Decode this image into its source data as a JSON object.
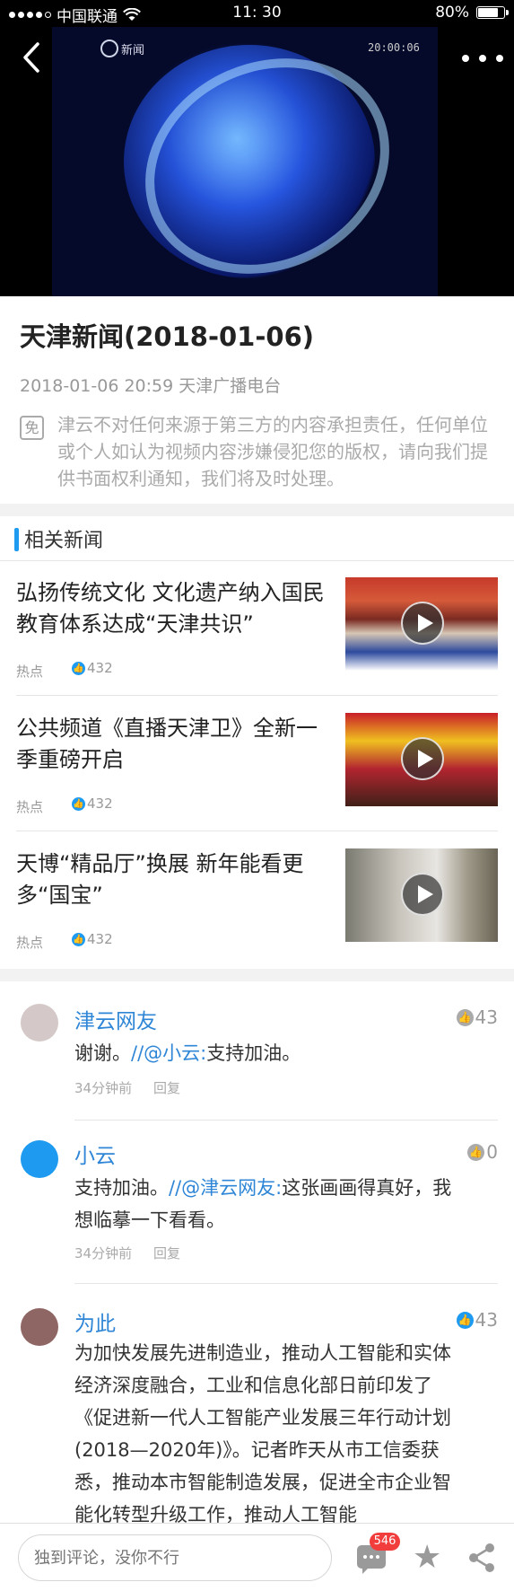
{
  "status_bar": {
    "carrier": "中国联通",
    "time": "11: 30",
    "battery": "80%",
    "battery_level": 0.8
  },
  "video": {
    "channel_logo_text": "新闻",
    "timecode": "20:00:06"
  },
  "article": {
    "title": "天津新闻(2018-01-06)",
    "date": "2018-01-06 20:59",
    "source": "天津广播电台",
    "disclaimer_icon": "免",
    "disclaimer": "津云不对任何来源于第三方的内容承担责任，任何单位或个人如认为视频内容涉嫌侵犯您的版权，请向我们提供书面权利通知，我们将及时处理。"
  },
  "related": {
    "section_title": "相关新闻",
    "items": [
      {
        "title": "弘扬传统文化 文化遗产纳入国民教育体系达成“天津共识”",
        "tag": "热点",
        "likes": "432"
      },
      {
        "title": "公共频道《直播天津卫》全新一季重磅开启",
        "tag": "热点",
        "likes": "432"
      },
      {
        "title": "天博“精品厅”换展 新年能看更多“国宝”",
        "tag": "热点",
        "likes": "432"
      }
    ]
  },
  "comments": [
    {
      "name": "津云网友",
      "likes": "43",
      "text_before": "谢谢。",
      "mention": "//@小云:",
      "text_after": "支持加油。",
      "time": "34分钟前",
      "reply": "回复",
      "avatar_color": "#d4c9c8"
    },
    {
      "name": "小云",
      "likes": "0",
      "text_before": "支持加油。",
      "mention": "//@津云网友:",
      "text_after": "这张画画得真好，我想临摹一下看看。",
      "time": "34分钟前",
      "reply": "回复",
      "avatar_color": "#1e9bf0"
    },
    {
      "name": "为此",
      "likes": "43",
      "text_before": "为加快发展先进制造业，推动人工智能和实体经济深度融合，工业和信息化部日前印发了《促进新一代人工智能产业发展三年行动计划(2018—2020年)》。记者昨天从市工信委获悉，推动本市智能制造发展，促进全市企业智能化转型升级工作，推动人工智能",
      "mention": "",
      "text_after": "",
      "avatar_color": "#8e6663"
    }
  ],
  "bottom_bar": {
    "input_placeholder": "独到评论，没你不行",
    "comment_count": "546"
  },
  "colors": {
    "accent": "#1e9bf0",
    "name_blue": "#2f86d6",
    "badge_red": "#f23d3d"
  }
}
